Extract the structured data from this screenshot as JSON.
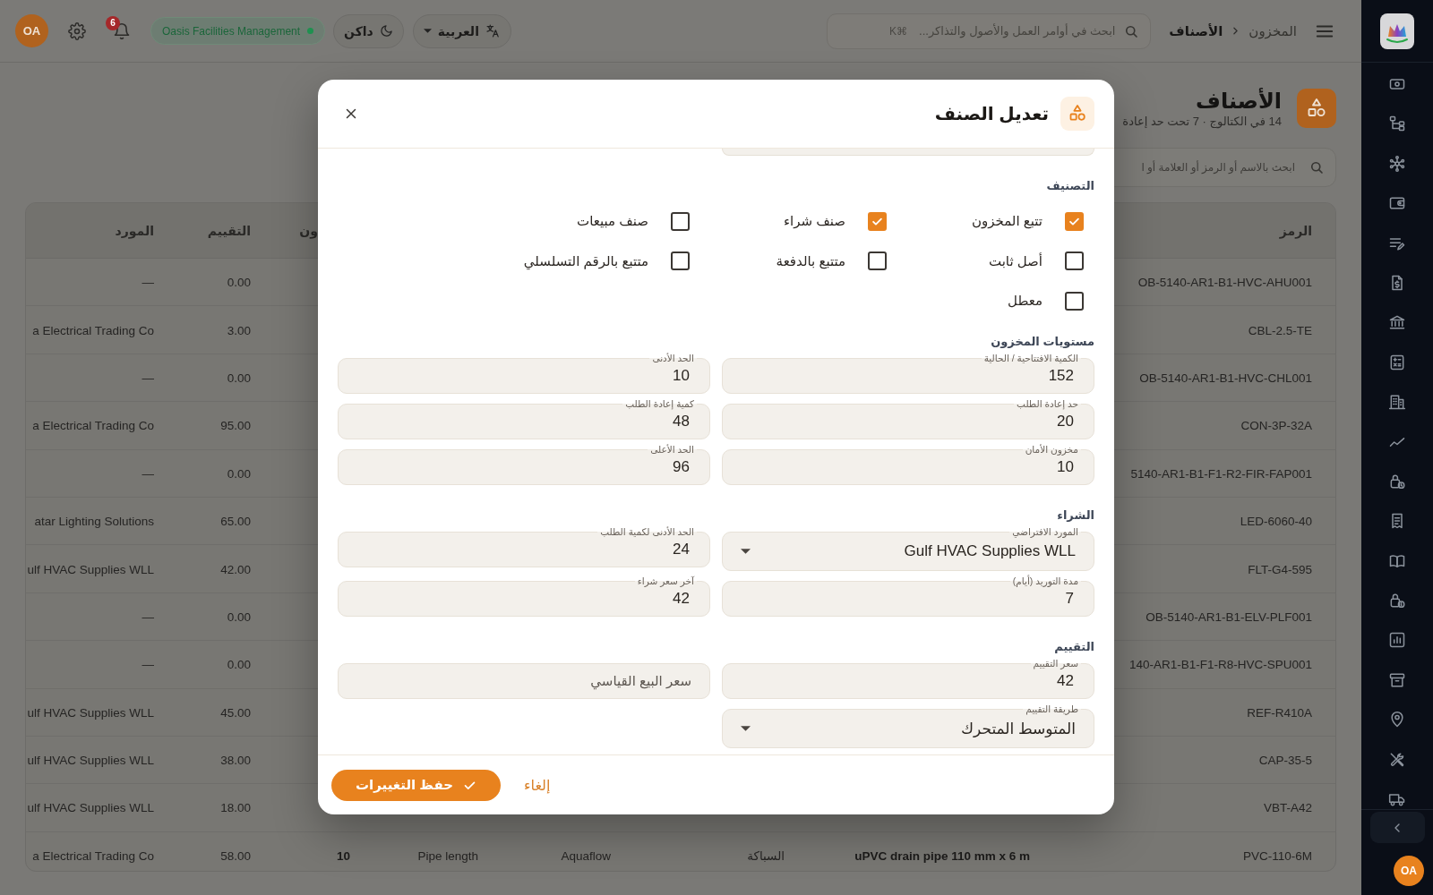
{
  "sidebar": {
    "avatar": "OA"
  },
  "top_bar": {
    "breadcrumbs": [
      {
        "label": "المخزون",
        "current": false
      },
      {
        "label": "الأصناف",
        "current": true
      }
    ],
    "search": {
      "placeholder": "ابحث في أوامر العمل والأصول والتذاكر...",
      "shortcut": "⌘K"
    },
    "language": "العربية",
    "theme": "داكن",
    "tenant": "Oasis Facilities Management",
    "notifications": "6",
    "avatar": "OA"
  },
  "page": {
    "title": "الأصناف",
    "subtitle": "14 في الكتالوج · 7 تحت حد إعادة",
    "search": {
      "placeholder": "ابحث بالاسم أو الرمز أو العلامة أو ا"
    }
  },
  "table": {
    "header": {
      "code": "الرمز",
      "column_6": "ون",
      "valuation": "التقييم",
      "supplier": "المورد"
    },
    "rows": [
      {
        "code": "OB-5140-AR1-B1-HVC-AHU001",
        "valuation": "0.00",
        "supplier": "—"
      },
      {
        "code": "CBL-2.5-TE",
        "valuation": "3.00",
        "supplier": "a Electrical Trading Co"
      },
      {
        "code": "OB-5140-AR1-B1-HVC-CHL001",
        "valuation": "0.00",
        "supplier": "—"
      },
      {
        "code": "CON-3P-32A",
        "valuation": "95.00",
        "supplier": "a Electrical Trading Co"
      },
      {
        "code": "5140-AR1-B1-F1-R2-FIR-FAP001",
        "valuation": "0.00",
        "supplier": "—"
      },
      {
        "code": "LED-6060-40",
        "valuation": "65.00",
        "supplier": "atar Lighting Solutions"
      },
      {
        "code": "FLT-G4-595",
        "valuation": "42.00",
        "supplier": "ulf HVAC Supplies WLL"
      },
      {
        "code": "OB-5140-AR1-B1-ELV-PLF001",
        "valuation": "0.00",
        "supplier": "—"
      },
      {
        "code": "140-AR1-B1-F1-R8-HVC-SPU001",
        "valuation": "0.00",
        "supplier": "—"
      },
      {
        "code": "REF-R410A",
        "valuation": "45.00",
        "supplier": "ulf HVAC Supplies WLL"
      },
      {
        "code": "CAP-35-5",
        "valuation": "38.00",
        "supplier": "ulf HVAC Supplies WLL"
      },
      {
        "code": "VBT-A42",
        "valuation": "18.00",
        "supplier": "ulf HVAC Supplies WLL"
      },
      {
        "code": "PVC-110-6M",
        "column_2": "uPVC drain pipe 110 mm x 6 m",
        "column_3": "السباكة",
        "column_4": "Aquaflow",
        "column_5": "Pipe length",
        "column_6": "10",
        "valuation": "58.00",
        "supplier": "a Electrical Trading Co"
      }
    ]
  },
  "dialog": {
    "title": "تعديل الصنف",
    "sections": [
      {
        "kind": "checkboxes",
        "title": "التصنيف",
        "options": [
          {
            "label": "تتبع المخزون",
            "checked": true
          },
          {
            "label": "صنف شراء",
            "checked": true
          },
          {
            "label": "صنف مبيعات",
            "checked": false
          },
          {
            "label": "أصل ثابت",
            "checked": false
          },
          {
            "label": "متتبع بالدفعة",
            "checked": false
          },
          {
            "label": "متتبع بالرقم التسلسلي",
            "checked": false
          },
          {
            "label": "معطل",
            "checked": false
          }
        ]
      },
      {
        "kind": "fields",
        "title": "مستويات المخزون",
        "fields": [
          {
            "kind": "input",
            "label": "الكمية الافتتاحية / الحالية",
            "value": "152"
          },
          {
            "kind": "input",
            "label": "الحد الأدنى",
            "value": "10"
          },
          {
            "kind": "input",
            "label": "حد إعادة الطلب",
            "value": "20"
          },
          {
            "kind": "input",
            "label": "كمية إعادة الطلب",
            "value": "48"
          },
          {
            "kind": "input",
            "label": "مخزون الأمان",
            "value": "10"
          },
          {
            "kind": "input",
            "label": "الحد الأعلى",
            "value": "96"
          }
        ]
      },
      {
        "kind": "fields",
        "title": "الشراء",
        "fields": [
          {
            "kind": "select",
            "label": "المورد الافتراضي",
            "value": "Gulf HVAC Supplies WLL"
          },
          {
            "kind": "input",
            "label": "الحد الأدنى لكمية الطلب",
            "value": "24"
          },
          {
            "kind": "input",
            "label": "مدة التوريد (أيام)",
            "value": "7"
          },
          {
            "kind": "input",
            "label": "آخر سعر شراء",
            "value": "42"
          }
        ]
      },
      {
        "kind": "fields",
        "title": "التقييم",
        "fields": [
          {
            "kind": "input",
            "label": "سعر التقييم",
            "value": "42"
          },
          {
            "kind": "input",
            "placeholder": "سعر البيع القياسي"
          },
          {
            "kind": "select",
            "label": "طريقة التقييم",
            "value": "المتوسط المتحرك"
          }
        ]
      }
    ],
    "buttons": [
      {
        "kind": "link",
        "label": "إلغاء"
      },
      {
        "kind": "primary",
        "label": "حفظ التغييرات"
      }
    ]
  }
}
